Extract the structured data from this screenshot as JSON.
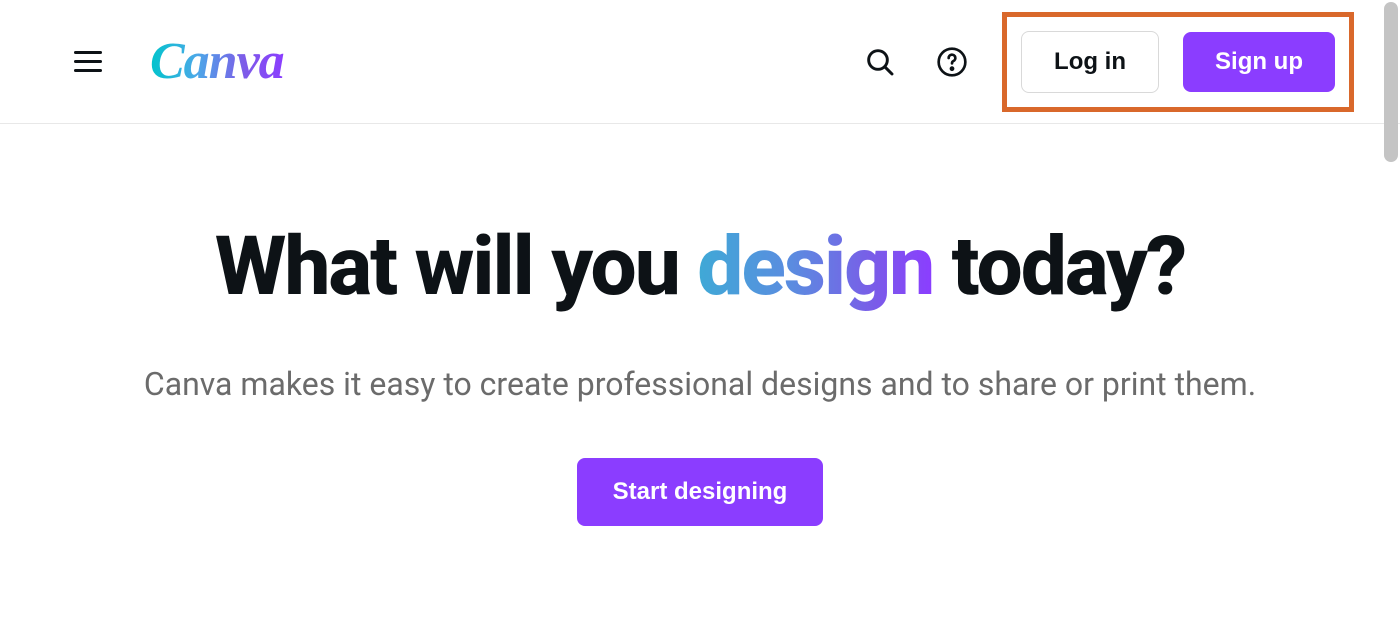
{
  "header": {
    "logo_text": "Canva",
    "login_label": "Log in",
    "signup_label": "Sign up"
  },
  "hero": {
    "title_before": "What will you ",
    "title_accent": "design",
    "title_after": " today?",
    "subtitle": "Canva makes it easy to create professional designs and to share or print them.",
    "cta_label": "Start designing"
  },
  "colors": {
    "primary": "#8b3dff",
    "highlight_box": "#d9682b"
  }
}
